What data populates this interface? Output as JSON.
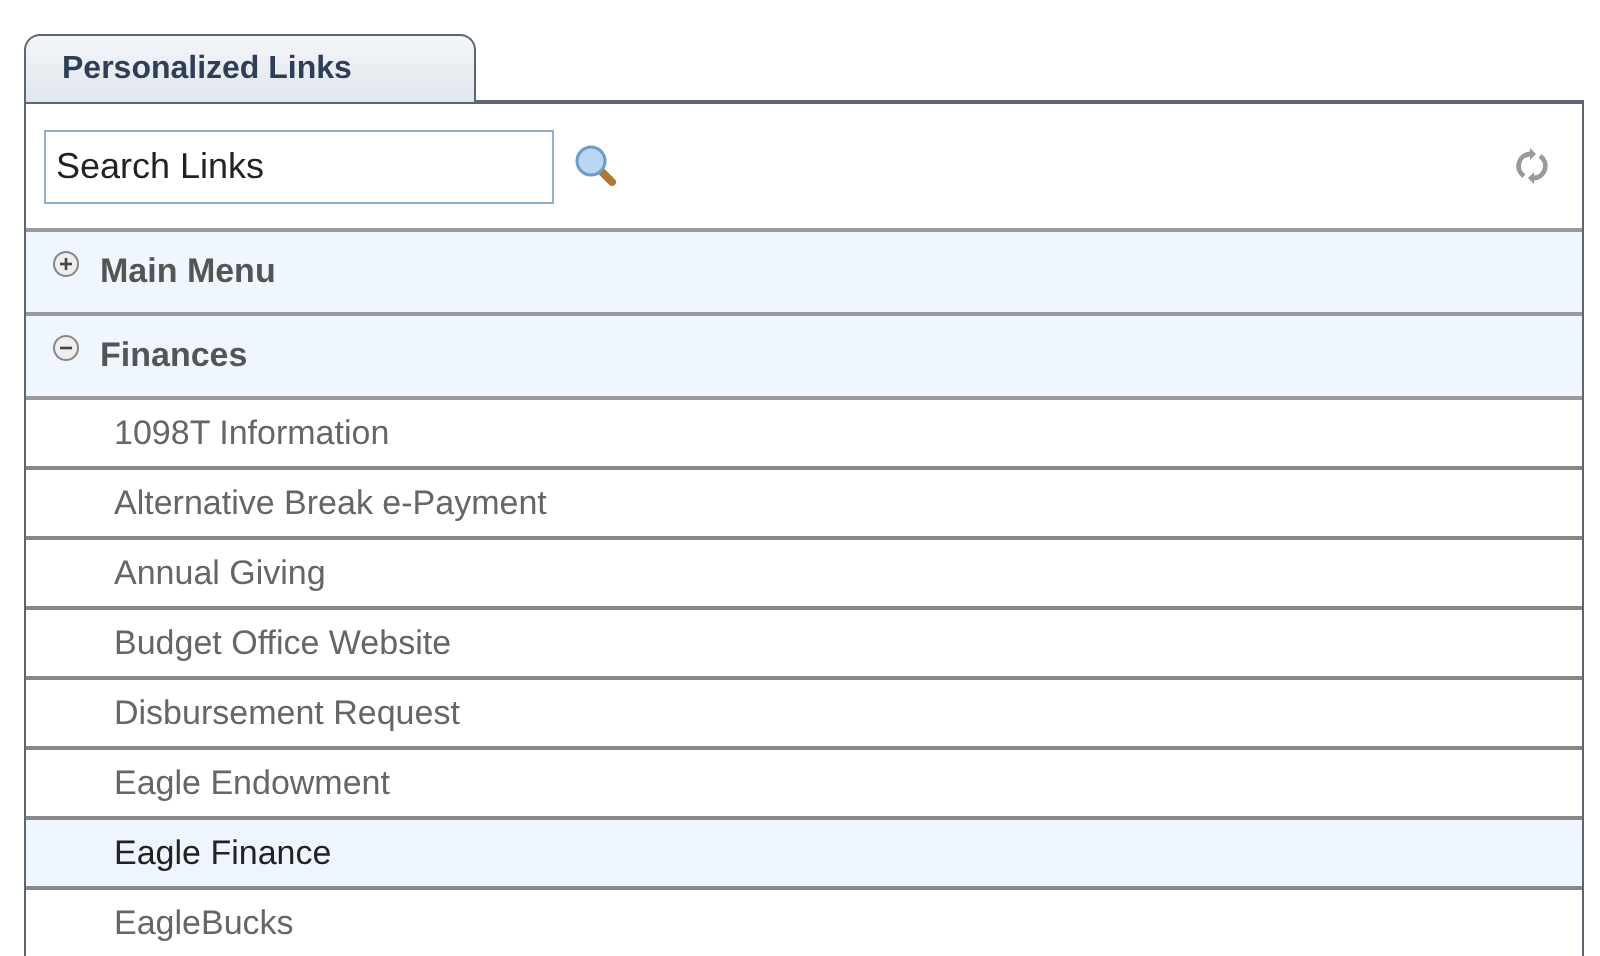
{
  "tab": {
    "label": "Personalized Links"
  },
  "search": {
    "value": "Search Links"
  },
  "categories": [
    {
      "label": "Main Menu",
      "expanded": false
    },
    {
      "label": "Finances",
      "expanded": true,
      "children": [
        {
          "label": "1098T Information",
          "selected": false
        },
        {
          "label": "Alternative Break e-Payment",
          "selected": false
        },
        {
          "label": "Annual Giving",
          "selected": false
        },
        {
          "label": "Budget Office Website",
          "selected": false
        },
        {
          "label": "Disbursement Request",
          "selected": false
        },
        {
          "label": "Eagle Endowment",
          "selected": false
        },
        {
          "label": "Eagle Finance",
          "selected": true
        },
        {
          "label": "EagleBucks",
          "selected": false
        }
      ]
    }
  ]
}
